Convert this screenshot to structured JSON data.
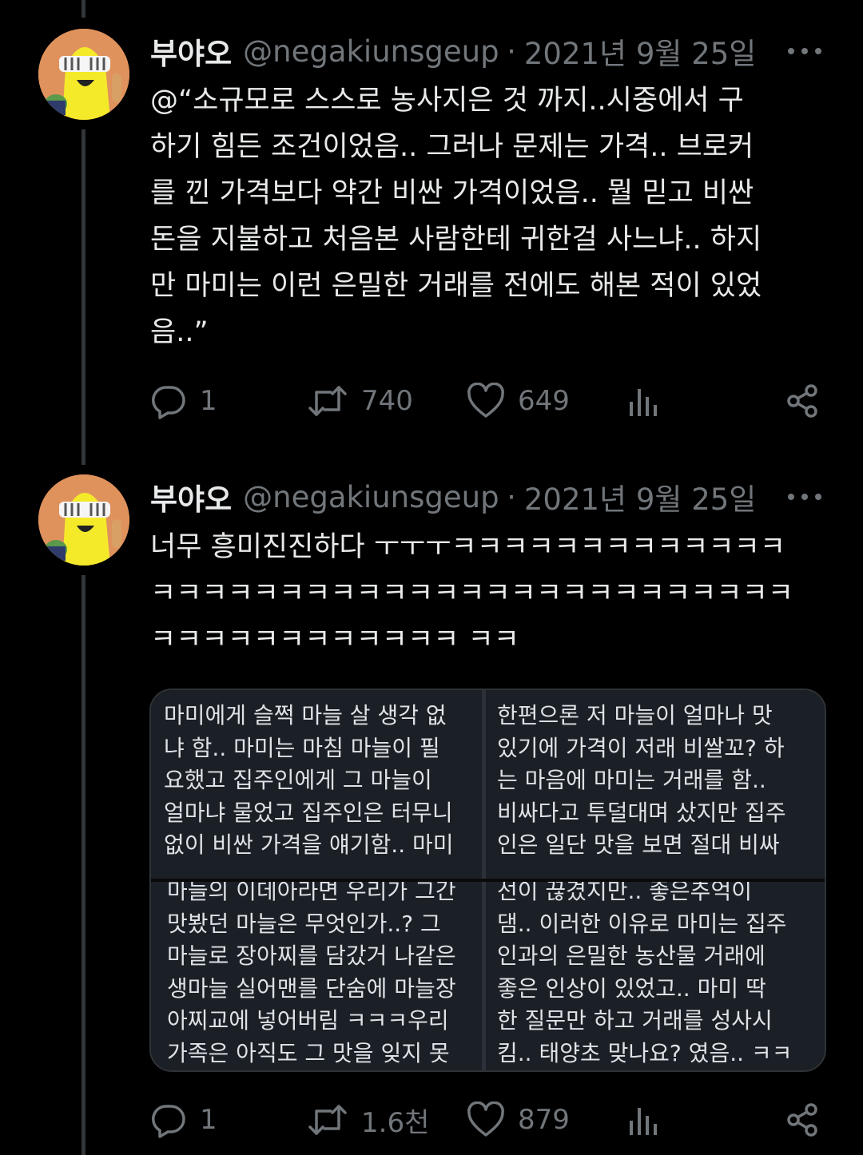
{
  "tweets": [
    {
      "author_name": "부야오",
      "handle": "@negakiunsgeup",
      "separator": "·",
      "date": "2021년 9월 25일",
      "lines": [
        "@“소규모로 스스로 농사지은 것 까지..시중에서 구",
        "하기 힘든 조건이었음.. 그러나 문제는 가격.. 브로커",
        "를 낀 가격보다 약간 비싼 가격이었음.. 뭘 믿고 비싼",
        "돈을 지불하고 처음본 사람한테 귀한걸 사느냐.. 하지",
        "만 마미는  이런 은밀한 거래를 전에도 해본 적이 있었",
        "음..”"
      ],
      "actions": {
        "replies": "1",
        "retweets": "740",
        "likes": "649"
      }
    },
    {
      "author_name": "부야오",
      "handle": "@negakiunsgeup",
      "separator": "·",
      "date": "2021년 9월 25일",
      "lines": [
        "너무 흥미진진하다 ㅜㅜㅜㅋㅋㅋㅋㅋㅋㅋㅋㅋㅋㅋㅋㅋ",
        "ㅋㅋㅋㅋㅋㅋㅋㅋㅋㅋㅋㅋㅋㅋㅋㅋㅋㅋㅋㅋㅋㅋㅋㅋㅋ",
        "ㅋㅋㅋㅋㅋㅋㅋㅋㅋㅋㅋㅋ ㅋㅋ"
      ],
      "media": {
        "top_left": [
          "마미에게 슬쩍 마늘 살 생각 없",
          "냐 함.. 마미는 마침 마늘이 필",
          "요했고 집주인에게 그 마늘이",
          "얼마냐 물었고 집주인은 터무니",
          "없이 비싼 가격을 얘기함.. 마미"
        ],
        "top_right": [
          "한편으론 저 마늘이 얼마나 맛",
          "있기에 가격이 저래 비쌀꼬? 하",
          "는 마음에 마미는 거래를 함..",
          "비싸다고 투덜대며 샀지만 집주",
          "인은 일단 맛을 보면 절대 비싸"
        ],
        "bottom_left": [
          "마늘의 이데아라면 우리가 그간",
          "맛봤던 마늘은 무엇인가..? 그",
          "마늘로 장아찌를 담갔거 나같은",
          "생마늘 실어맨를 단숨에 마늘장",
          "아찌교에 넣어버림 ㅋㅋㅋ우리",
          "가족은 아직도 그 맛을 잊지 못"
        ],
        "bottom_right": [
          "선이 끊겼지만.. 좋은추억이",
          "댐.. 이러한 이유로 마미는 집주",
          "인과의 은밀한 농산물 거래에",
          "좋은 인상이 있었고.. 마미 딱",
          "한 질문만 하고 거래를 성사시",
          "킴.. 태양초 맞나요? 였음.. ㅋㅋ"
        ]
      },
      "actions": {
        "replies": "1",
        "retweets": "1.6천",
        "likes": "879"
      }
    }
  ],
  "colors": {
    "background": "#000000",
    "text": "#e7e9ea",
    "secondary": "#71767b",
    "thread_line": "#333639"
  },
  "icons": [
    "reply-icon",
    "retweet-icon",
    "like-icon",
    "views-icon",
    "share-icon",
    "more-icon"
  ]
}
